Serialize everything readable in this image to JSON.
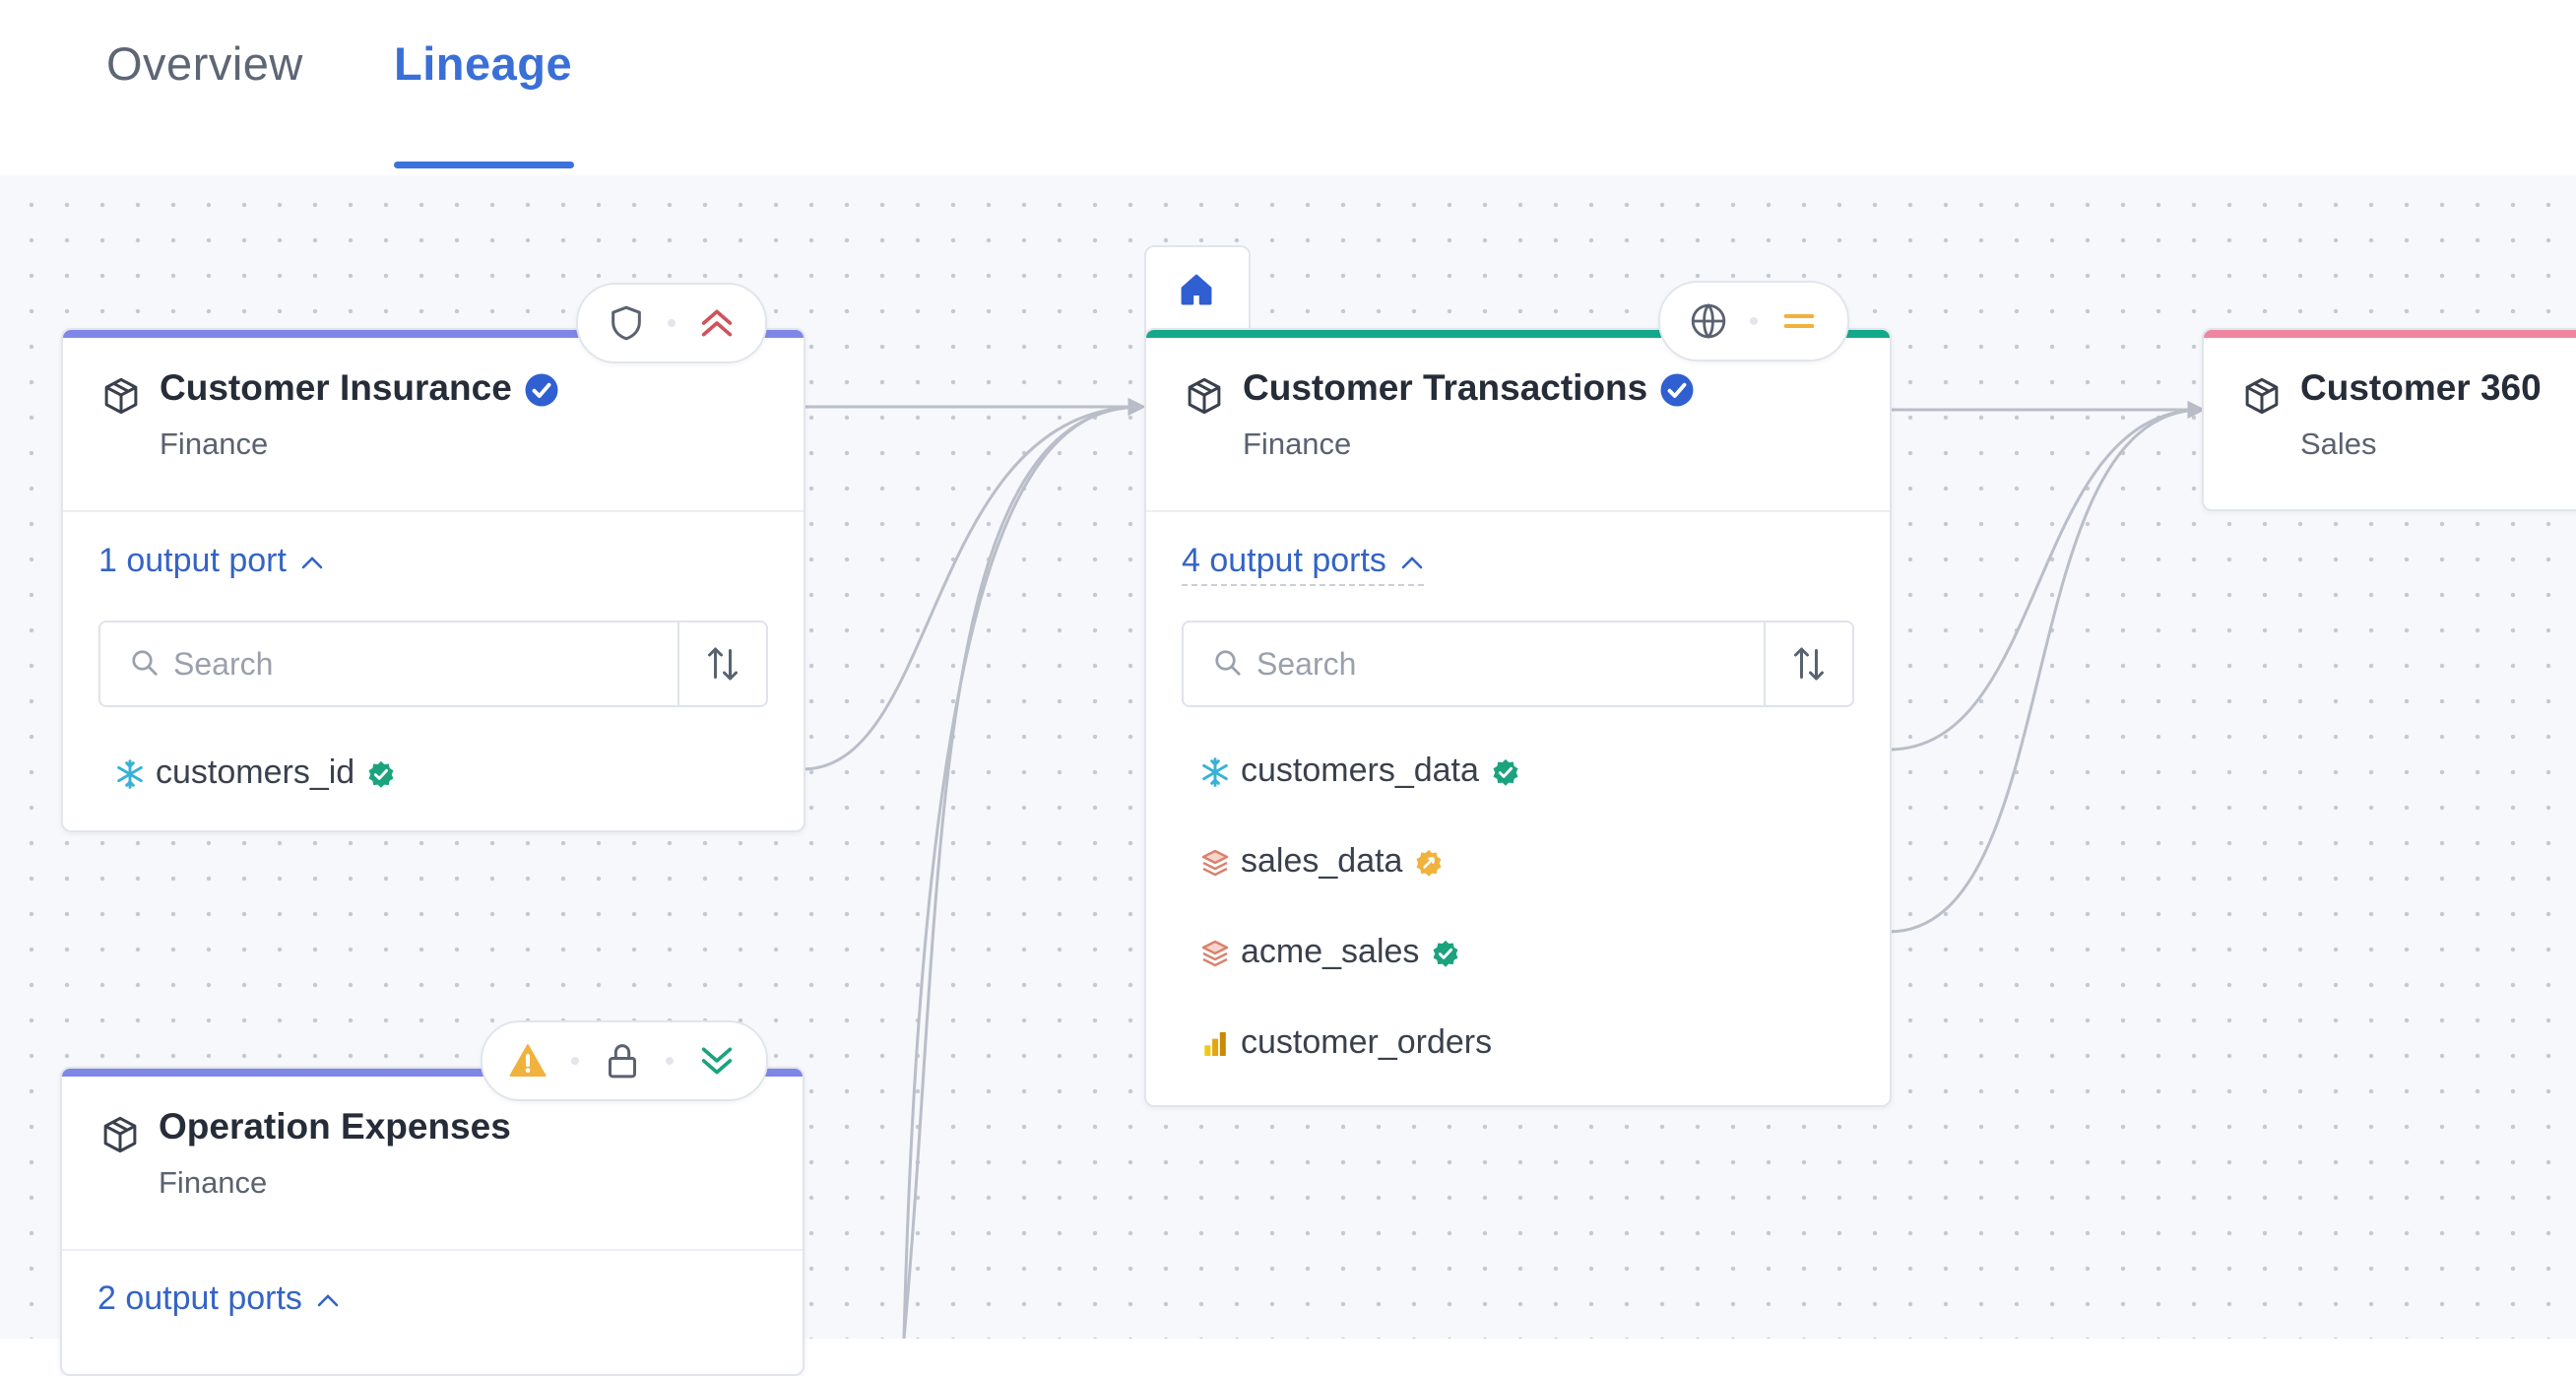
{
  "tabs": [
    {
      "label": "Overview",
      "active": false
    },
    {
      "label": "Lineage",
      "active": true
    }
  ],
  "colors": {
    "accent": "#3b72db",
    "edge": "#b7bcc6",
    "domain_bar_finance": "#7f86e8",
    "domain_bar_transactions": "#13a98a",
    "domain_bar_sales": "#ef86a0",
    "verified_blue": "#2f5fd0",
    "status_green": "#1ba37e",
    "status_amber": "#f0b23c"
  },
  "nodes": {
    "customer_insurance": {
      "title": "Customer Insurance",
      "verified": true,
      "domain": "Finance",
      "badges": [
        "shield-icon",
        "chevrons-up-icon"
      ],
      "ports_label": "1 output port",
      "search_placeholder": "Search",
      "ports": [
        {
          "name": "customers_id",
          "platform": "snowflake-icon",
          "status": "verified-green"
        }
      ]
    },
    "operation_expenses": {
      "title": "Operation Expenses",
      "verified": false,
      "domain": "Finance",
      "badges": [
        "warning-icon",
        "lock-icon",
        "chevrons-down-icon"
      ],
      "ports_label": "2 output ports"
    },
    "customer_transactions": {
      "title": "Customer Transactions",
      "verified": true,
      "domain": "Finance",
      "badges": [
        "globe-icon",
        "equals-icon"
      ],
      "home_icon": "home-icon",
      "ports_label": "4 output ports",
      "search_placeholder": "Search",
      "ports": [
        {
          "name": "customers_data",
          "platform": "snowflake-icon",
          "status": "verified-green"
        },
        {
          "name": "sales_data",
          "platform": "layers-icon",
          "status": "verified-amber"
        },
        {
          "name": "acme_sales",
          "platform": "layers-icon",
          "status": "verified-green"
        },
        {
          "name": "customer_orders",
          "platform": "bar-chart-icon",
          "status": ""
        }
      ]
    },
    "customer_360": {
      "title": "Customer 360",
      "domain": "Sales"
    }
  }
}
